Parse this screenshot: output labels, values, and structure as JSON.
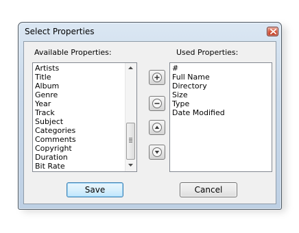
{
  "window": {
    "title": "Select Properties"
  },
  "available": {
    "label": "Available Properties:",
    "items": [
      "Artists",
      "Title",
      "Album",
      "Genre",
      "Year",
      "Track",
      "Subject",
      "Categories",
      "Comments",
      "Copyright",
      "Duration",
      "Bit Rate"
    ]
  },
  "used": {
    "label": "Used Properties:",
    "items": [
      "#",
      "Full Name",
      "Directory",
      "Size",
      "Type",
      "Date Modified"
    ]
  },
  "buttons": {
    "save_label": "Save",
    "cancel_label": "Cancel"
  },
  "move_buttons": [
    {
      "icon": "plus-circle-icon"
    },
    {
      "icon": "minus-circle-icon"
    },
    {
      "icon": "up-arrow-circle-icon"
    },
    {
      "icon": "down-arrow-circle-icon"
    }
  ],
  "colors": {
    "title_bar": "#c9d9ea",
    "close_button": "#c8452d",
    "default_button_border": "#3c7fb1",
    "dialog_face": "#f0f0f0"
  }
}
